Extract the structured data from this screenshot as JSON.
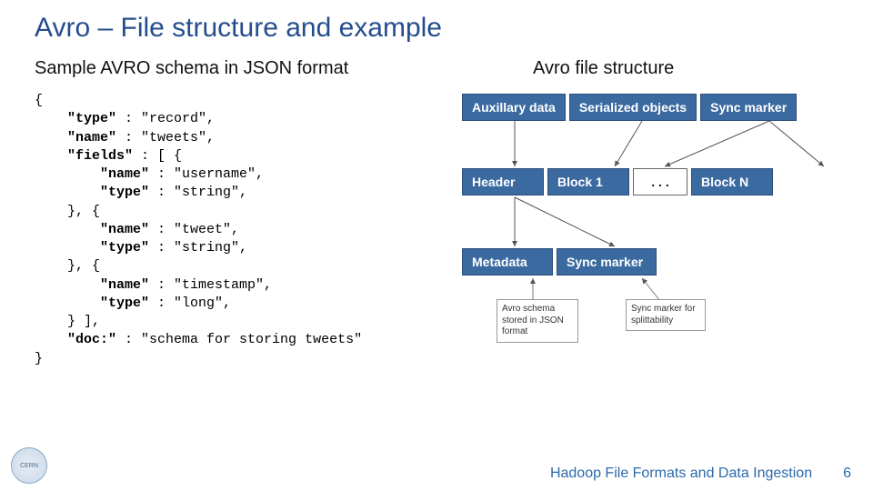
{
  "title": "Avro – File structure and example",
  "left": {
    "subhead": "Sample AVRO schema in JSON format",
    "code_lines": [
      {
        "indent": 0,
        "bold": "",
        "rest": "{"
      },
      {
        "indent": 1,
        "bold": "\"type\"",
        "rest": " : \"record\","
      },
      {
        "indent": 1,
        "bold": "\"name\"",
        "rest": " : \"tweets\","
      },
      {
        "indent": 1,
        "bold": "\"fields\"",
        "rest": " : [ {"
      },
      {
        "indent": 2,
        "bold": "\"name\"",
        "rest": " : \"username\","
      },
      {
        "indent": 2,
        "bold": "\"type\"",
        "rest": " : \"string\","
      },
      {
        "indent": 1,
        "bold": "",
        "rest": "}, {"
      },
      {
        "indent": 2,
        "bold": "\"name\"",
        "rest": " : \"tweet\","
      },
      {
        "indent": 2,
        "bold": "\"type\"",
        "rest": " : \"string\","
      },
      {
        "indent": 1,
        "bold": "",
        "rest": "}, {"
      },
      {
        "indent": 2,
        "bold": "\"name\"",
        "rest": " : \"timestamp\","
      },
      {
        "indent": 2,
        "bold": "\"type\"",
        "rest": " : \"long\","
      },
      {
        "indent": 1,
        "bold": "",
        "rest": "} ],"
      },
      {
        "indent": 1,
        "bold": "\"doc:\"",
        "rest": " : \"schema for storing tweets\""
      },
      {
        "indent": 0,
        "bold": "",
        "rest": "}"
      }
    ]
  },
  "right": {
    "subhead": "Avro file structure",
    "top_boxes": [
      "Auxillary data",
      "Serialized objects",
      "Sync marker"
    ],
    "mid_boxes": [
      "Header",
      "Block 1",
      ". . .",
      "Block N"
    ],
    "hdr_boxes": [
      "Metadata",
      "Sync marker"
    ],
    "note_schema": "Avro schema stored in JSON format",
    "note_sync": "Sync marker for splittability"
  },
  "footer": {
    "text": "Hadoop File Formats and Data Ingestion",
    "page": "6",
    "logo": "CERN"
  }
}
